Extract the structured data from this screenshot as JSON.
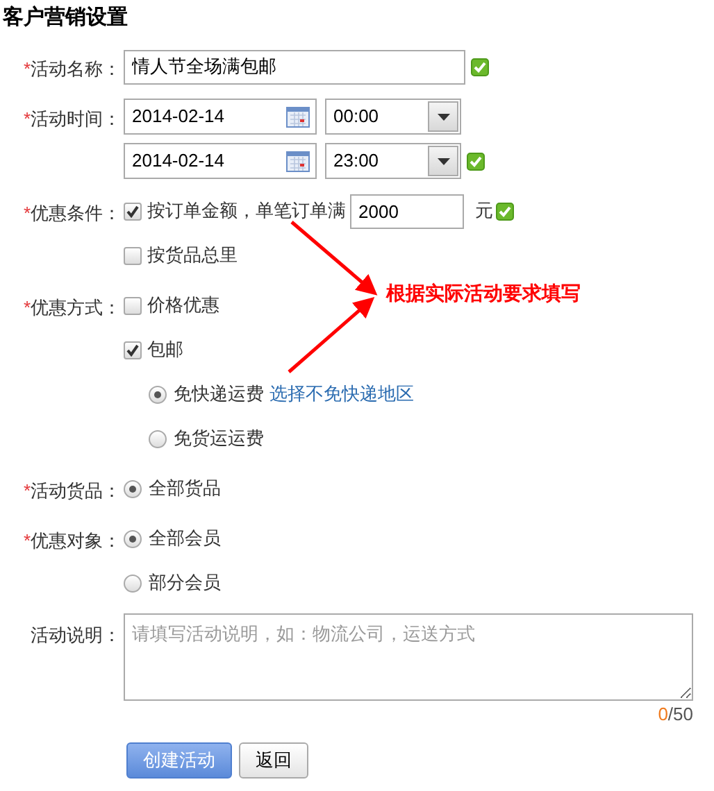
{
  "title": "客户营销设置",
  "fields": [
    {
      "required_mark": "*",
      "label": "活动名称：",
      "kind": "text",
      "value": "情人节全场满包邮",
      "valid": true
    },
    {
      "required_mark": "*",
      "label": "活动时间：",
      "kind": "datetime",
      "rows": [
        {
          "date": "2014-02-14",
          "time": "00:00",
          "valid": false
        },
        {
          "date": "2014-02-14",
          "time": "23:00",
          "valid": true
        }
      ]
    },
    {
      "required_mark": "*",
      "label": "优惠条件：",
      "kind": "checkboxes",
      "options": [
        {
          "label": "按订单金额，单笔订单满",
          "checked": true,
          "amount": "2000",
          "unit": "元",
          "valid": true
        },
        {
          "label": "按货品总里",
          "checked": false
        }
      ]
    },
    {
      "required_mark": "*",
      "label": "优惠方式：",
      "kind": "checkboxes",
      "options": [
        {
          "label": "价格优惠",
          "checked": false
        },
        {
          "label": "包邮",
          "checked": true,
          "sub_options": [
            {
              "label": "免快递运费",
              "selected": true,
              "link": "选择不免快递地区"
            },
            {
              "label": "免货运运费",
              "selected": false
            }
          ]
        }
      ]
    },
    {
      "required_mark": "*",
      "label": "活动货品：",
      "kind": "radios",
      "options": [
        {
          "label": "全部货品",
          "selected": true
        }
      ]
    },
    {
      "required_mark": "*",
      "label": "优惠对象：",
      "kind": "radios",
      "options": [
        {
          "label": "全部会员",
          "selected": true
        },
        {
          "label": "部分会员",
          "selected": false
        }
      ]
    },
    {
      "label": "活动说明：",
      "kind": "textarea",
      "placeholder": "请填写活动说明，如：物流公司，运送方式",
      "count": "0",
      "limit": "/50"
    }
  ],
  "buttons": [
    {
      "label": "创建活动",
      "kind": "primary"
    },
    {
      "label": "返回",
      "kind": "default"
    }
  ],
  "annotation": {
    "text": "根据实际活动要求填写"
  }
}
